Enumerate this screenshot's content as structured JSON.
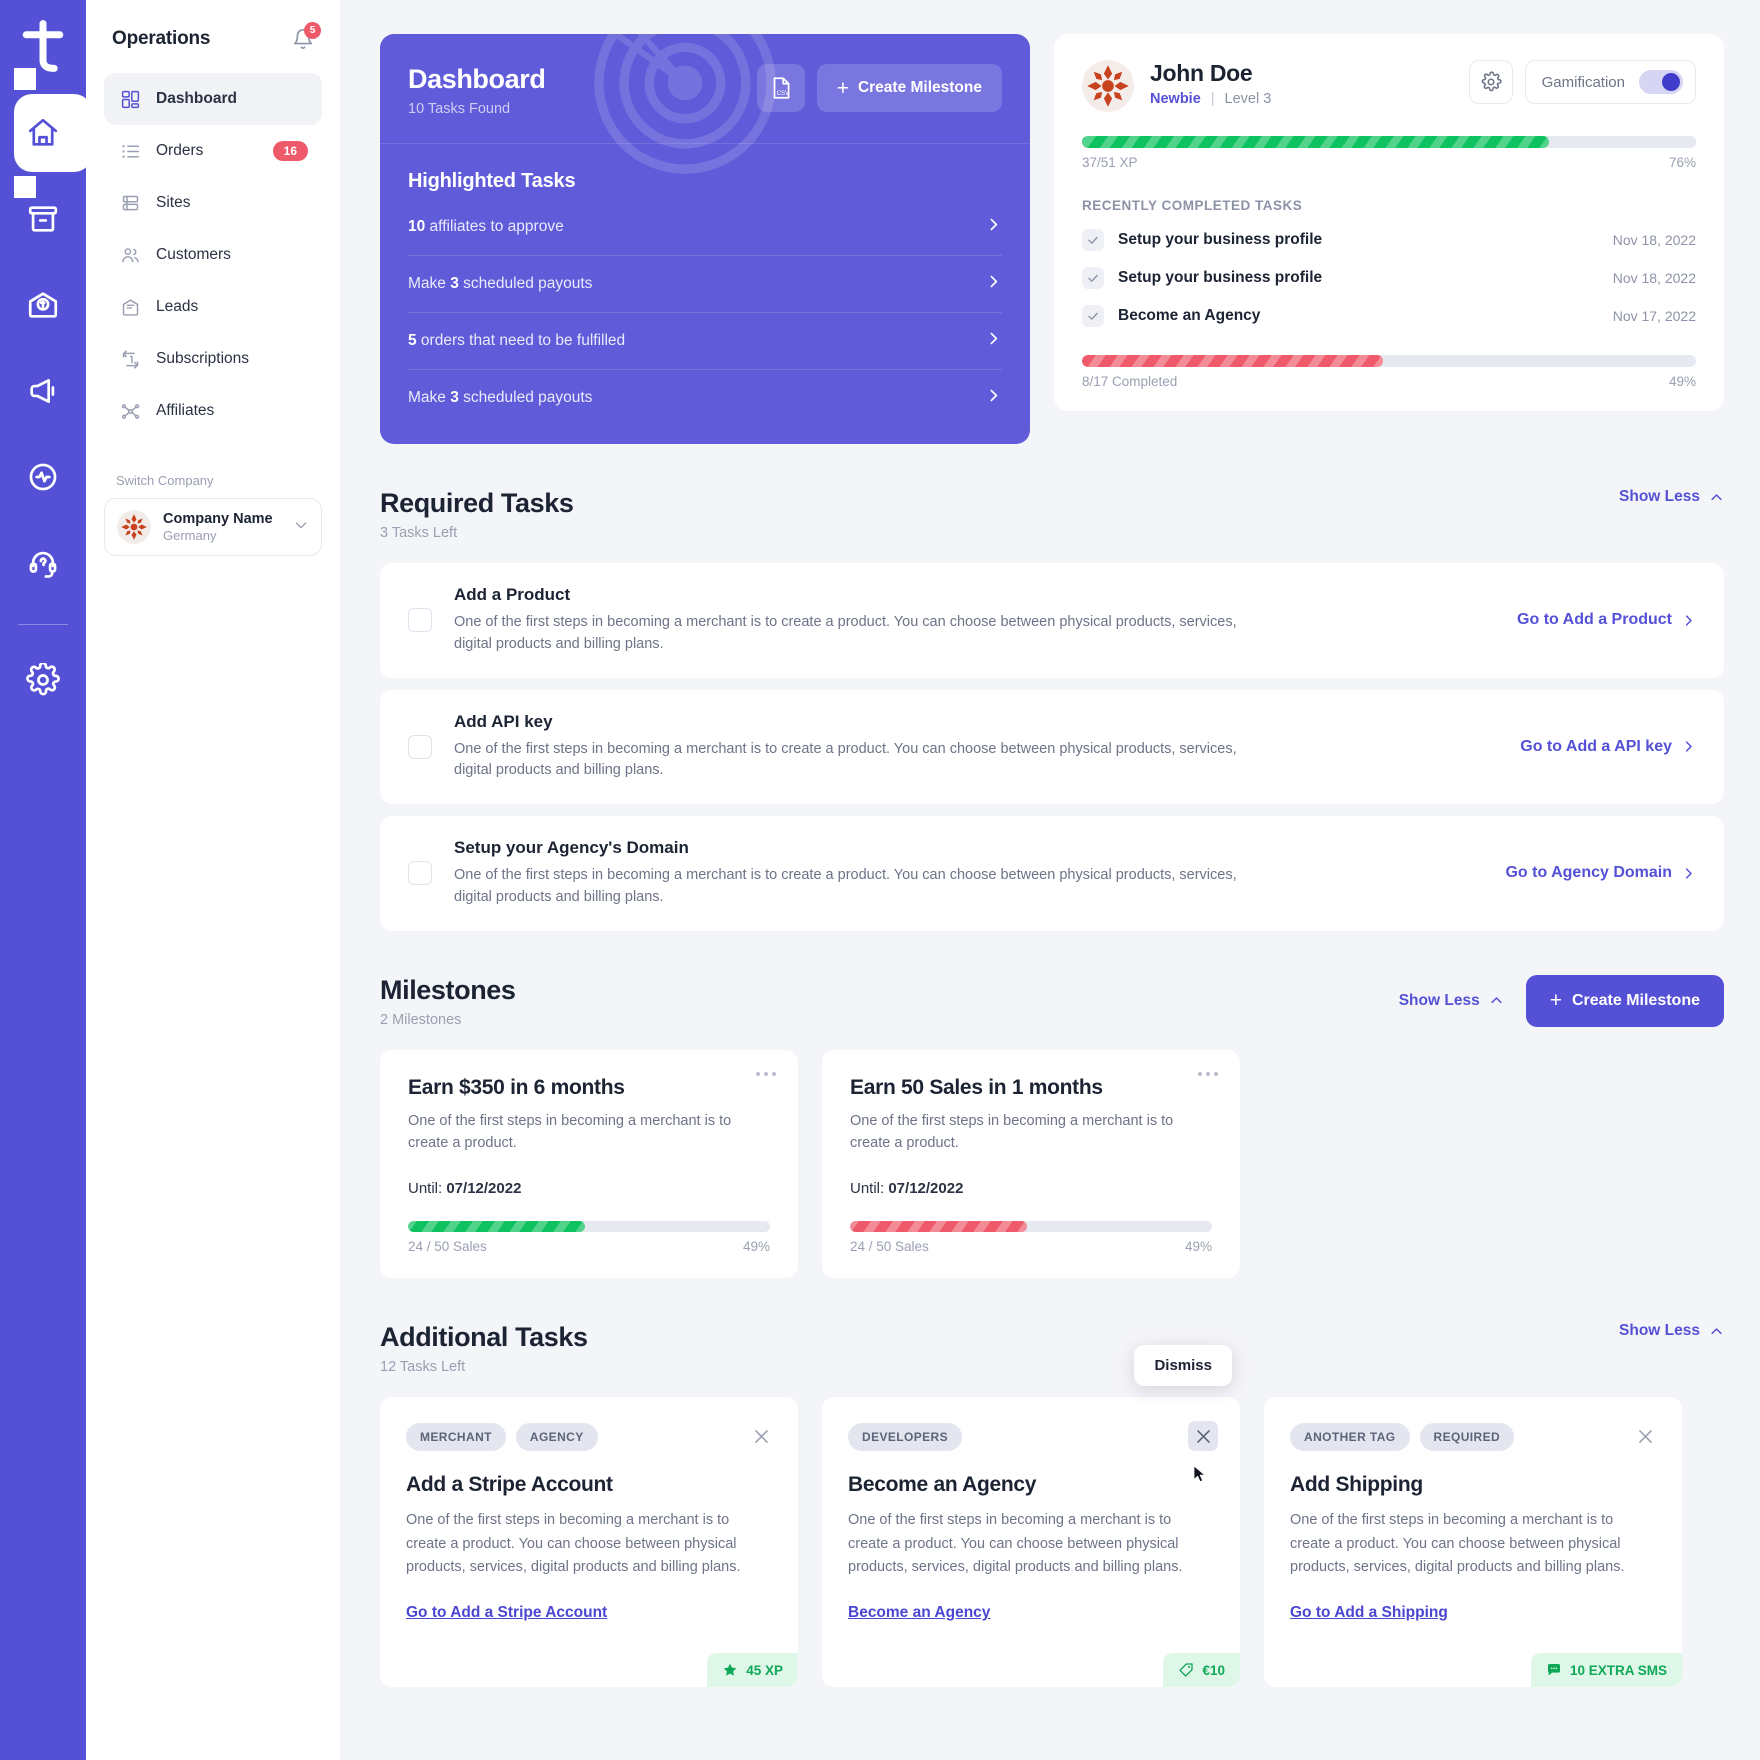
{
  "rail": {
    "logo_icon": "tapfiliate-logo-icon",
    "items": [
      {
        "icon": "home-icon",
        "name": "home",
        "active": true
      },
      {
        "icon": "archive-box-icon",
        "name": "archive",
        "active": false
      },
      {
        "icon": "money-envelope-icon",
        "name": "payouts",
        "active": false
      },
      {
        "icon": "megaphone-icon",
        "name": "campaigns",
        "active": false
      },
      {
        "icon": "pulse-activity-icon",
        "name": "activity",
        "active": false
      },
      {
        "icon": "headset-help-icon",
        "name": "support",
        "active": false
      },
      {
        "icon": "gear-icon",
        "name": "settings",
        "active": false
      }
    ]
  },
  "sidebar": {
    "title": "Operations",
    "bell_icon": "bell-icon",
    "notification_count": "5",
    "items": [
      {
        "label": "Dashboard",
        "icon": "grid-dashboard-icon",
        "badge": "",
        "active": true
      },
      {
        "label": "Orders",
        "icon": "list-icon",
        "badge": "16",
        "active": false
      },
      {
        "label": "Sites",
        "icon": "sites-icon",
        "badge": "",
        "active": false
      },
      {
        "label": "Customers",
        "icon": "users-icon",
        "badge": "",
        "active": false
      },
      {
        "label": "Leads",
        "icon": "leads-icon",
        "badge": "",
        "active": false
      },
      {
        "label": "Subscriptions",
        "icon": "repeat-icon",
        "badge": "",
        "active": false
      },
      {
        "label": "Affiliates",
        "icon": "network-icon",
        "badge": "",
        "active": false
      }
    ],
    "switch_company_label": "Switch Company",
    "company": {
      "name": "Company Name",
      "country": "Germany",
      "chevron_icon": "chevron-down-icon"
    }
  },
  "dashboard_card": {
    "title": "Dashboard",
    "subtitle": "10 Tasks Found",
    "csv_icon": "csv-file-icon",
    "create_milestone_label": "Create Milestone",
    "highlighted_title": "Highlighted Tasks",
    "highlighted_tasks": [
      {
        "prefix": "10",
        "text": " affiliates to approve",
        "bold_first": true
      },
      {
        "prefix": "Make ",
        "bold": "3",
        "suffix": " scheduled payouts",
        "bold_first": false
      },
      {
        "prefix": "5",
        "text": " orders that need to be fulfilled",
        "bold_first": true
      },
      {
        "prefix": "Make ",
        "bold": "3",
        "suffix": " scheduled payouts",
        "bold_first": false
      }
    ]
  },
  "profile_card": {
    "avatar_icon": "identicon-avatar",
    "name": "John Doe",
    "rank": "Newbie",
    "divider": "|",
    "level": "Level 3",
    "gear_icon": "gear-icon",
    "gamification_label": "Gamification",
    "gamification_on": true,
    "xp_text": "37/51 XP",
    "xp_percent_label": "76%",
    "xp_percent": 76,
    "recently_completed_title": "RECENTLY COMPLETED TASKS",
    "completed_tasks": [
      {
        "label": "Setup your business profile",
        "date": "Nov 18, 2022"
      },
      {
        "label": "Setup your business profile",
        "date": "Nov 18, 2022"
      },
      {
        "label": "Become an Agency",
        "date": "Nov 17, 2022"
      }
    ],
    "completed_text": "8/17 Completed",
    "completed_percent_label": "49%",
    "completed_percent": 49
  },
  "required_tasks": {
    "title": "Required Tasks",
    "subtitle": "3 Tasks Left",
    "show_less_label": "Show Less",
    "items": [
      {
        "title": "Add a Product",
        "desc": "One of the first steps in becoming a merchant is to create a product. You can choose between physical products, services, digital products and billing plans.",
        "link": "Go to Add a Product"
      },
      {
        "title": "Add API key",
        "desc": "One of the first steps in becoming a merchant is to create a product. You can choose between physical products, services, digital products and billing plans.",
        "link": "Go to Add a API key"
      },
      {
        "title": "Setup your Agency's Domain",
        "desc": "One of the first steps in becoming a merchant is to create a product. You can choose between physical products, services, digital products and billing plans.",
        "link": "Go to Agency Domain"
      }
    ]
  },
  "milestones": {
    "title": "Milestones",
    "subtitle": "2 Milestones",
    "show_less_label": "Show Less",
    "create_label": "Create Milestone",
    "items": [
      {
        "title": "Earn $350 in 6 months",
        "desc": "One of the first steps in becoming a merchant is to create a product.",
        "until_label": "Until: ",
        "until_date": "07/12/2022",
        "progress_text": "24 / 50 Sales",
        "percent_label": "49%",
        "percent": 49,
        "color": "green"
      },
      {
        "title": "Earn 50 Sales in 1 months",
        "desc": "One of the first steps in becoming a merchant is to create a product.",
        "until_label": "Until: ",
        "until_date": "07/12/2022",
        "progress_text": "24 / 50 Sales",
        "percent_label": "49%",
        "percent": 49,
        "color": "red"
      }
    ]
  },
  "additional_tasks": {
    "title": "Additional Tasks",
    "subtitle": "12 Tasks Left",
    "show_less_label": "Show Less",
    "tooltip": "Dismiss",
    "items": [
      {
        "tags": [
          "MERCHANT",
          "AGENCY"
        ],
        "title": "Add a Stripe Account",
        "desc": "One of the first steps in becoming a merchant is to create a product. You can choose between physical products, services, digital products and billing plans.",
        "link": "Go to Add a Stripe Account",
        "reward": "45 XP",
        "reward_icon": "star-icon",
        "close_hovered": false
      },
      {
        "tags": [
          "DEVELOPERS"
        ],
        "title": "Become an Agency",
        "desc": "One of the first steps in becoming a merchant is to create a product. You can choose between physical products, services, digital products and billing plans.",
        "link": "Become an Agency",
        "reward": "€10",
        "reward_icon": "price-tag-icon",
        "close_hovered": true
      },
      {
        "tags": [
          "ANOTHER TAG",
          "REQUIRED"
        ],
        "title": "Add Shipping",
        "desc": "One of the first steps in becoming a merchant is to create a product. You can choose between physical products, services, digital products and billing plans.",
        "link": "Go to Add a Shipping",
        "reward": "10 EXTRA SMS",
        "reward_icon": "sms-icon",
        "close_hovered": false
      }
    ]
  },
  "colors": {
    "brand": "#5551d6",
    "card_purple": "#5f5bd9",
    "danger": "#ef5a6b",
    "success": "#0fc260",
    "page_bg": "#f4f5f9"
  }
}
